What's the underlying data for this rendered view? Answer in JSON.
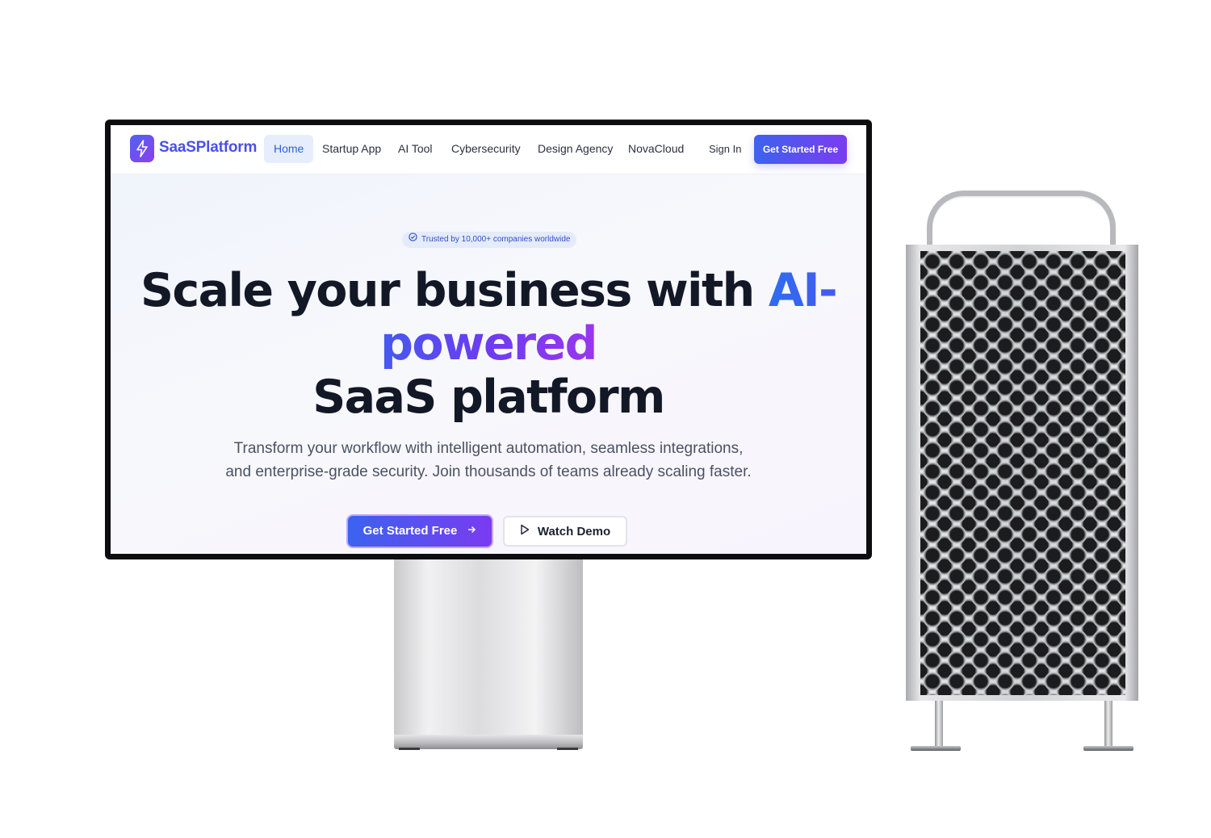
{
  "nav": {
    "logo_text": "SaaSPlatform",
    "items": [
      "Home",
      "Startup App",
      "AI Tool",
      "Cybersecurity",
      "Design Agency",
      "NovaCloud"
    ],
    "active_item": "Home",
    "sign_in": "Sign In",
    "cta": "Get Started Free"
  },
  "hero": {
    "badge": "Trusted by 10,000+ companies worldwide",
    "headline_part1": "Scale your business with ",
    "headline_highlight": "AI-powered",
    "headline_part2": "SaaS platform",
    "subtext_line1": "Transform your workflow with intelligent automation, seamless integrations,",
    "subtext_line2": "and enterprise-grade security. Join thousands of teams already scaling faster.",
    "primary_button": "Get Started Free",
    "secondary_button": "Watch Demo"
  },
  "colors": {
    "brand_blue": "#3b63ef",
    "brand_purple": "#7a3bf0",
    "heading": "#131827"
  },
  "icons": [
    "lightning-icon",
    "check-circle-icon",
    "arrow-right-icon",
    "play-icon"
  ]
}
